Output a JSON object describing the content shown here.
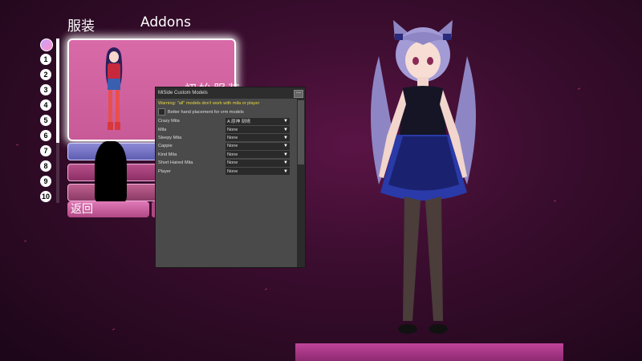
{
  "header": {
    "tab_clothes": "服装",
    "tab_addons": "Addons"
  },
  "numbers": [
    "1",
    "2",
    "3",
    "4",
    "5",
    "6",
    "7",
    "8",
    "9",
    "10"
  ],
  "outfit": {
    "card_label": "初始服装",
    "back_label": "返回"
  },
  "mod_window": {
    "title": "MiSide Custom Models",
    "minimize": "—",
    "warning": "Warning: \"all\" models don't work with mila or player",
    "checkbox_label": "Better hand placement for vrm models",
    "rows": [
      {
        "name": "Crazy Mita",
        "value": "A 原神 刻晴"
      },
      {
        "name": "Mila",
        "value": "None"
      },
      {
        "name": "Sleepy Mita",
        "value": "None"
      },
      {
        "name": "Cappie",
        "value": "None"
      },
      {
        "name": "Kind Mita",
        "value": "None"
      },
      {
        "name": "Short Haired Mita",
        "value": "None"
      },
      {
        "name": "Player",
        "value": "None"
      }
    ]
  },
  "colors": {
    "accent": "#d96aa8",
    "warning_text": "#e8d840",
    "background": "#3a0d2e"
  }
}
